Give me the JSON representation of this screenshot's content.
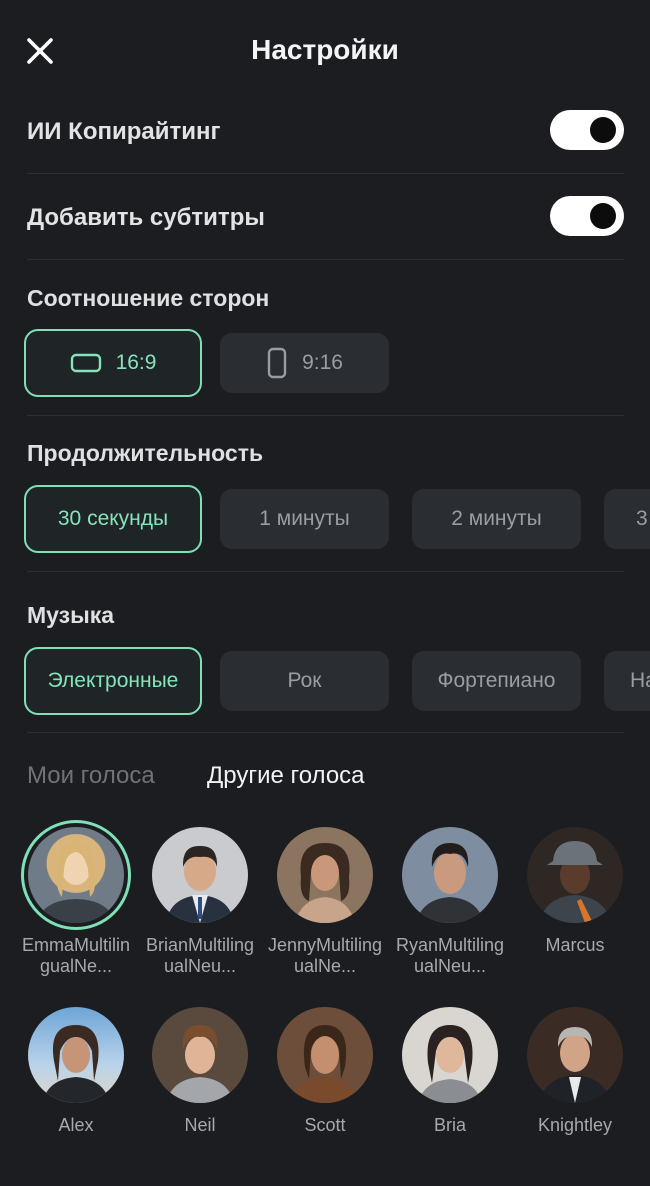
{
  "header": {
    "title": "Настройки",
    "close_icon": "close-icon"
  },
  "toggles": [
    {
      "label": "ИИ Копирайтинг",
      "on": true
    },
    {
      "label": "Добавить субтитры",
      "on": true
    }
  ],
  "aspect": {
    "title": "Соотношение сторон",
    "options": [
      {
        "label": "16:9",
        "icon": "landscape-icon",
        "selected": true
      },
      {
        "label": "9:16",
        "icon": "portrait-icon",
        "selected": false
      }
    ]
  },
  "duration": {
    "title": "Продолжительность",
    "options": [
      "30 секунды",
      "1 минуты",
      "2 минуты",
      "3"
    ],
    "selected": "30 секунды"
  },
  "music": {
    "title": "Музыка",
    "options": [
      "Электронные",
      "Рок",
      "Фортепиано",
      "На"
    ],
    "selected": "Электронные"
  },
  "voices": {
    "tabs": [
      "Мои голоса",
      "Другие голоса"
    ],
    "active_tab": "Другие голоса",
    "items": [
      {
        "name": "EmmaMultilingualNe...",
        "selected": true
      },
      {
        "name": "BrianMultilingualNeu...",
        "selected": false
      },
      {
        "name": "JennyMultilingualNe...",
        "selected": false
      },
      {
        "name": "RyanMultilingualNeu...",
        "selected": false
      },
      {
        "name": "Marcus",
        "selected": false
      },
      {
        "name": "Alex",
        "selected": false
      },
      {
        "name": "Neil",
        "selected": false
      },
      {
        "name": "Scott",
        "selected": false
      },
      {
        "name": "Bria",
        "selected": false
      },
      {
        "name": "Knightley",
        "selected": false
      }
    ]
  },
  "colors": {
    "accent": "#7ee0b6",
    "background": "#1b1d20",
    "chip": "#2a2d31"
  }
}
